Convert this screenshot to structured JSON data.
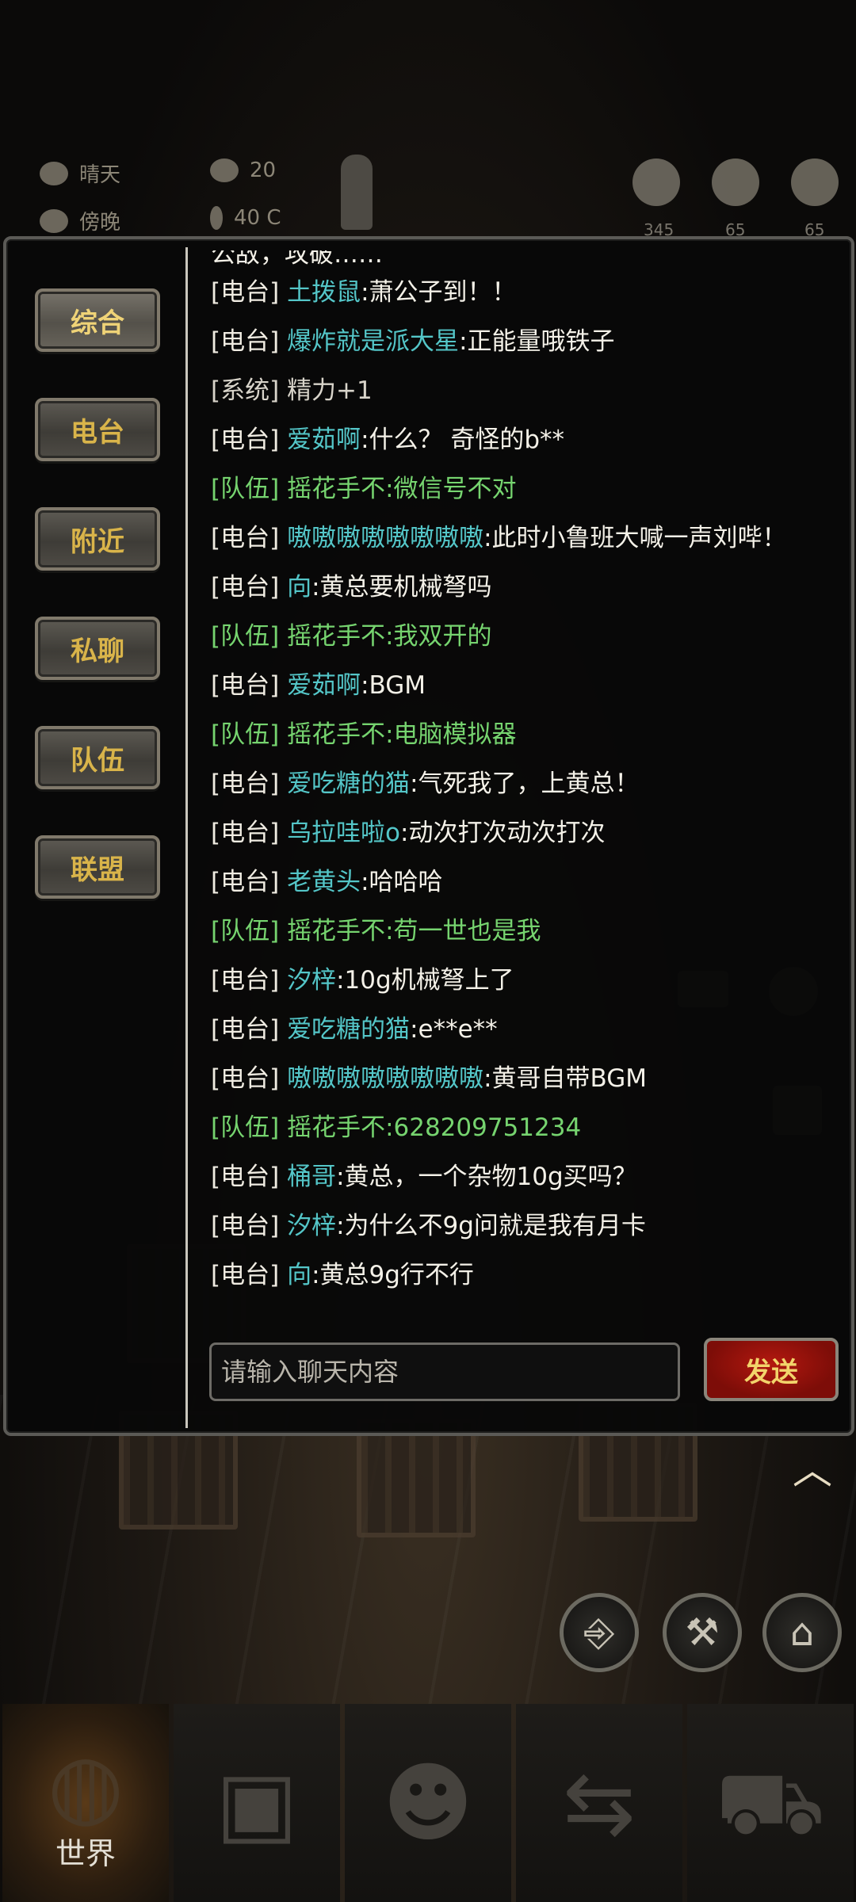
{
  "hud": {
    "weather": "晴天",
    "time_of_day": "傍晚",
    "radiation": "20",
    "temperature": "40 C",
    "health": "345",
    "hunger": "65",
    "mind": "65"
  },
  "chat": {
    "tabs": [
      {
        "label": "综合",
        "active": true
      },
      {
        "label": "电台",
        "active": false
      },
      {
        "label": "附近",
        "active": false
      },
      {
        "label": "私聊",
        "active": false
      },
      {
        "label": "队伍",
        "active": false
      },
      {
        "label": "联盟",
        "active": false
      }
    ],
    "messages": [
      {
        "type": "clip",
        "channel": "",
        "name": "",
        "text": "公敌，攻破……"
      },
      {
        "type": "radio",
        "channel": "[电台]",
        "name": "土拨鼠",
        "text": ":萧公子到！！"
      },
      {
        "type": "radio",
        "channel": "[电台]",
        "name": "爆炸就是派大星",
        "text": ":正能量哦铁子"
      },
      {
        "type": "system",
        "channel": "[系统]",
        "name": "",
        "text": "精力+1"
      },
      {
        "type": "radio",
        "channel": "[电台]",
        "name": "爱茹啊",
        "text": ":什么？ 奇怪的b**"
      },
      {
        "type": "team",
        "channel": "[队伍]",
        "name": "摇花手不",
        "text": ":微信号不对"
      },
      {
        "type": "radio",
        "channel": "[电台]",
        "name": "嗷嗷嗷嗷嗷嗷嗷嗷",
        "text": ":此时小鲁班大喊一声刘哔！"
      },
      {
        "type": "radio",
        "channel": "[电台]",
        "name": "向",
        "text": ":黄总要机械弩吗"
      },
      {
        "type": "team",
        "channel": "[队伍]",
        "name": "摇花手不",
        "text": ":我双开的"
      },
      {
        "type": "radio",
        "channel": "[电台]",
        "name": "爱茹啊",
        "text": ":BGM"
      },
      {
        "type": "team",
        "channel": "[队伍]",
        "name": "摇花手不",
        "text": ":电脑模拟器"
      },
      {
        "type": "radio",
        "channel": "[电台]",
        "name": "爱吃糖的猫",
        "text": ":气死我了，上黄总！"
      },
      {
        "type": "radio",
        "channel": "[电台]",
        "name": "乌拉哇啦o",
        "text": ":动次打次动次打次"
      },
      {
        "type": "radio",
        "channel": "[电台]",
        "name": "老黄头",
        "text": ":哈哈哈"
      },
      {
        "type": "team",
        "channel": "[队伍]",
        "name": "摇花手不",
        "text": ":苟一世也是我"
      },
      {
        "type": "radio",
        "channel": "[电台]",
        "name": "汐梓",
        "text": ":10g机械弩上了"
      },
      {
        "type": "radio",
        "channel": "[电台]",
        "name": "爱吃糖的猫",
        "text": ":e**e**"
      },
      {
        "type": "radio",
        "channel": "[电台]",
        "name": "嗷嗷嗷嗷嗷嗷嗷嗷",
        "text": ":黄哥自带BGM"
      },
      {
        "type": "team",
        "channel": "[队伍]",
        "name": "摇花手不",
        "text": ":628209751234"
      },
      {
        "type": "radio",
        "channel": "[电台]",
        "name": "桶哥",
        "text": ":黄总，一个杂物10g买吗？"
      },
      {
        "type": "radio",
        "channel": "[电台]",
        "name": "汐梓",
        "text": ":为什么不9g问就是我有月卡"
      },
      {
        "type": "radio",
        "channel": "[电台]",
        "name": "向",
        "text": ":黄总9g行不行"
      }
    ],
    "input_placeholder": "请输入聊天内容",
    "send_label": "发送"
  },
  "nav": {
    "items": [
      {
        "label": "世界",
        "icon": "globe-icon",
        "active": true
      },
      {
        "label": "",
        "icon": "suitcase-icon",
        "active": false
      },
      {
        "label": "",
        "icon": "head-gear-icon",
        "active": false
      },
      {
        "label": "",
        "icon": "swap-icon",
        "active": false
      },
      {
        "label": "",
        "icon": "cart-icon",
        "active": false
      }
    ]
  },
  "colors": {
    "tab_text": "#d9b44a",
    "radio_name": "#54c6c8",
    "team_text": "#76d46f",
    "send_bg": "#9b130c"
  }
}
